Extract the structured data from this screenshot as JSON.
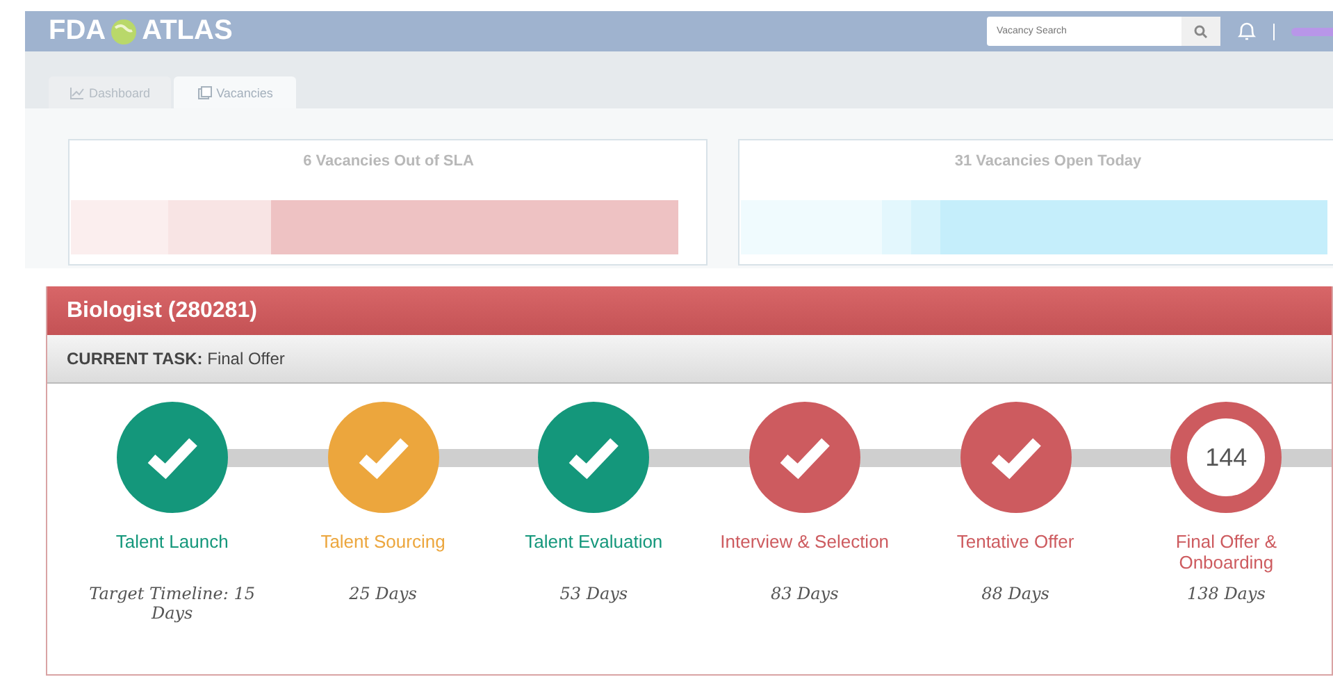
{
  "header": {
    "logo": "FDA",
    "logo_word": "ATLAS",
    "search": {
      "placeholder": "Vacancy Search"
    }
  },
  "tabs": [
    {
      "label": "Dashboard",
      "selected": false,
      "kind": "chart"
    },
    {
      "label": "Vacancies",
      "selected": true,
      "kind": "doc"
    }
  ],
  "cards": [
    {
      "title": "6 Vacancies Out of SLA",
      "kind": "red"
    },
    {
      "title": "31 Vacancies Open Today",
      "kind": "blue"
    }
  ],
  "position": {
    "title": "Biologist (280281)",
    "task_label": "CURRENT TASK:",
    "task": "Final Offer"
  },
  "stages": [
    {
      "label": "Talent Launch",
      "days": "Target Timeline: 15 Days",
      "color": "#14977b",
      "kind": "done"
    },
    {
      "label": "Talent Sourcing",
      "days": "25 Days",
      "color": "#eca63d",
      "kind": "done"
    },
    {
      "label": "Talent Evaluation",
      "days": "53 Days",
      "color": "#14977b",
      "kind": "done"
    },
    {
      "label": "Interview & Selection",
      "days": "83 Days",
      "color": "#cd5b5f",
      "kind": "done"
    },
    {
      "label": "Tentative Offer",
      "days": "88 Days",
      "color": "#cd5b5f",
      "kind": "done"
    },
    {
      "label": "Final Offer & Onboarding",
      "days": "138 Days",
      "color": "#cd5b5f",
      "kind": "current",
      "count": "144"
    }
  ]
}
